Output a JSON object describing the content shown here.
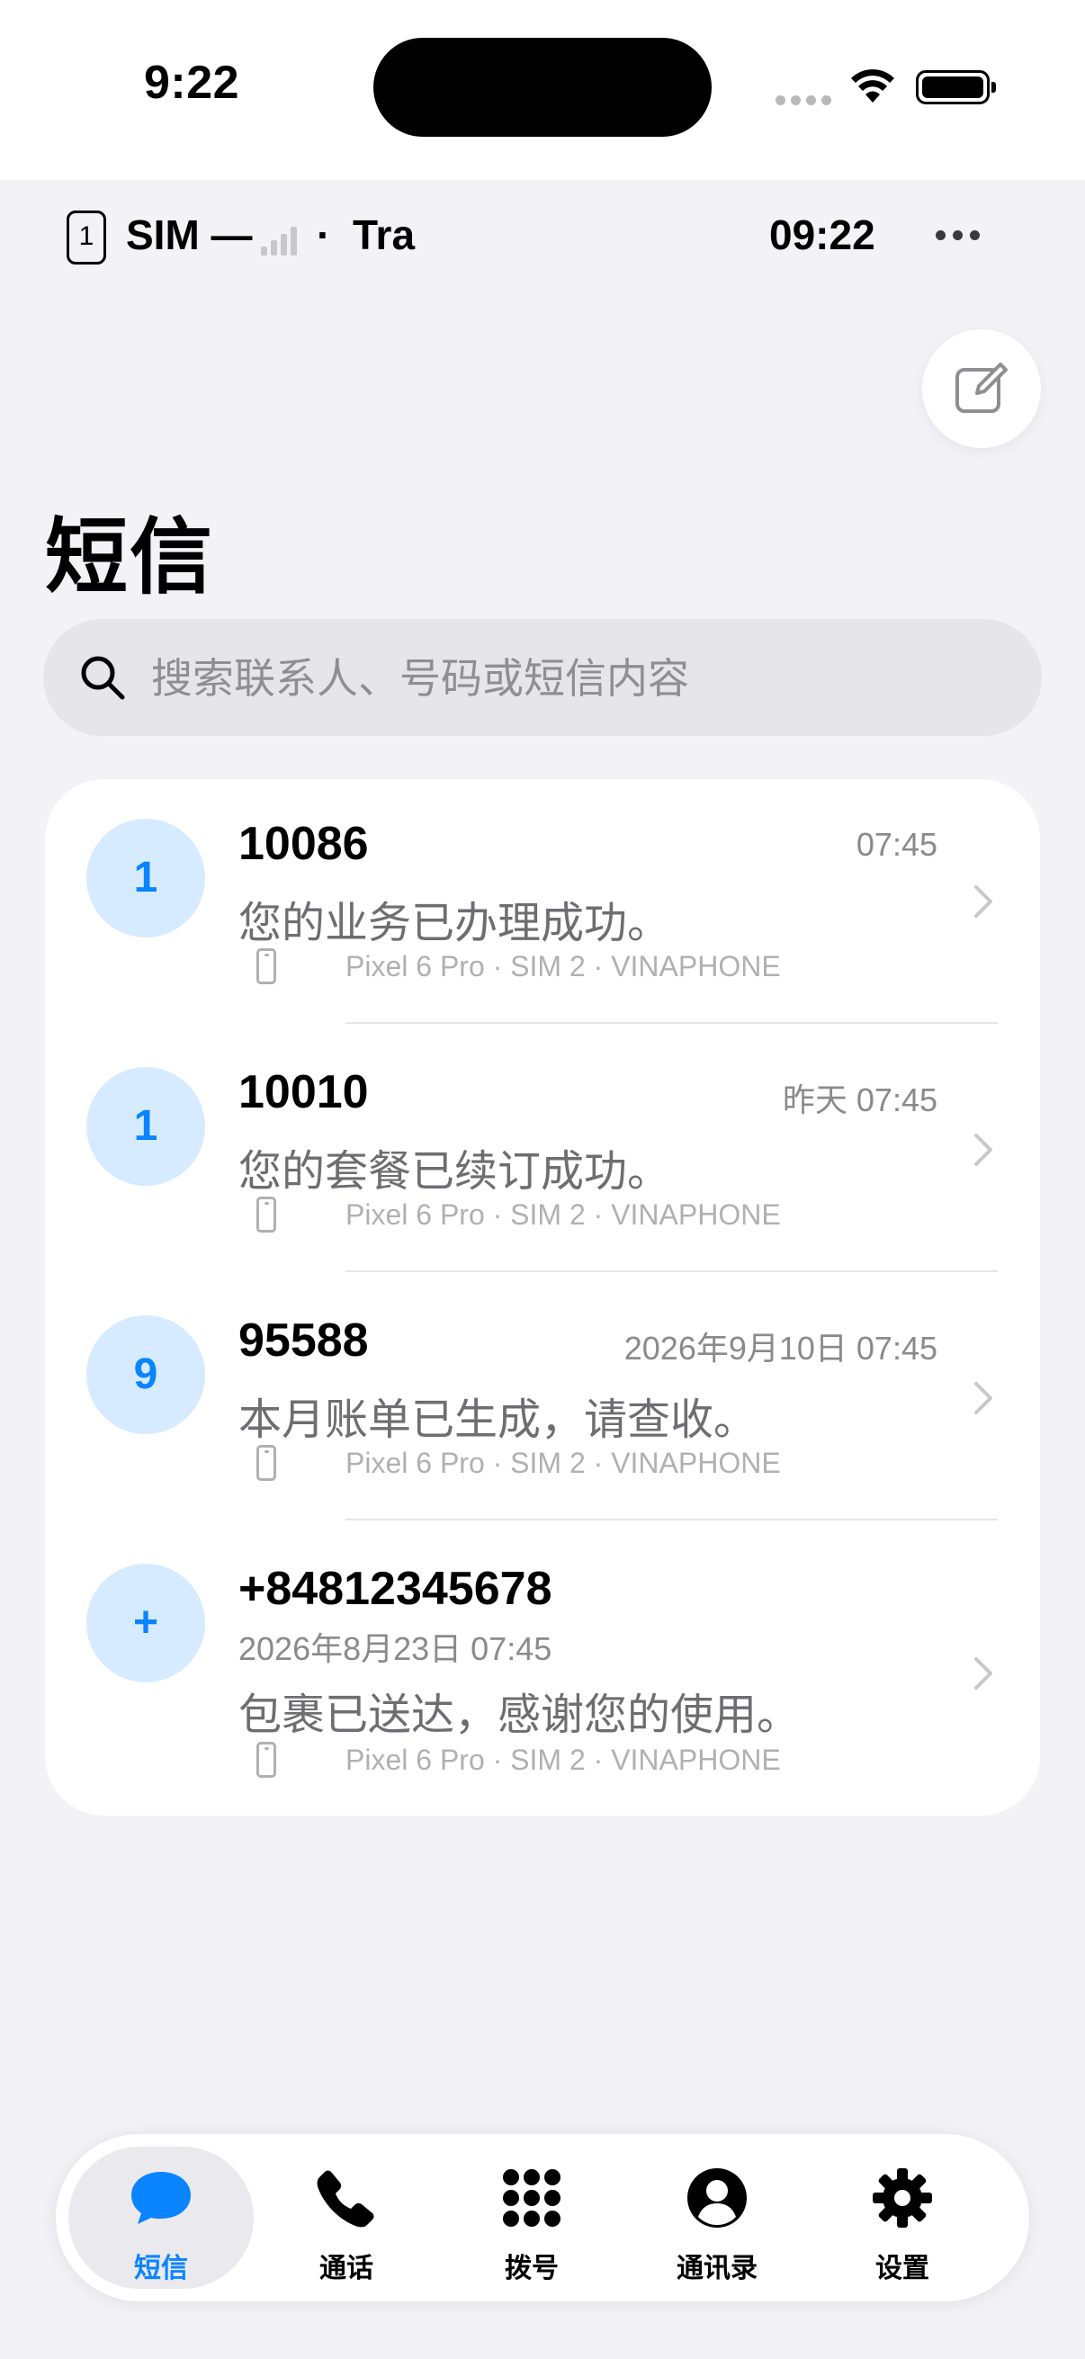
{
  "status_bar": {
    "time": "9:22"
  },
  "sim_bar": {
    "sim_number": "1",
    "sim_label": "SIM —",
    "separator": "·",
    "carrier": "Tra",
    "clock": "09:22"
  },
  "header": {
    "title": "短信",
    "search_placeholder": "搜索联系人、号码或短信内容"
  },
  "messages": [
    {
      "avatar": "1",
      "sender": "10086",
      "time": "07:45",
      "preview": "您的业务已办理成功。",
      "meta": "Pixel 6 Pro · SIM 2 · VINAPHONE"
    },
    {
      "avatar": "1",
      "sender": "10010",
      "time": "昨天 07:45",
      "preview": "您的套餐已续订成功。",
      "meta": "Pixel 6 Pro · SIM 2 · VINAPHONE"
    },
    {
      "avatar": "9",
      "sender": "95588",
      "time": "2026年9月10日 07:45",
      "preview": "本月账单已生成，请查收。",
      "meta": "Pixel 6 Pro · SIM 2 · VINAPHONE"
    },
    {
      "avatar": "+",
      "sender": "+84812345678",
      "time": "2026年8月23日 07:45",
      "preview": "包裹已送达，感谢您的使用。",
      "meta": "Pixel 6 Pro · SIM 2 · VINAPHONE"
    }
  ],
  "tabs": [
    {
      "label": "短信",
      "icon": "message-bubble-icon",
      "active": true
    },
    {
      "label": "通话",
      "icon": "phone-icon",
      "active": false
    },
    {
      "label": "拨号",
      "icon": "keypad-icon",
      "active": false
    },
    {
      "label": "通讯录",
      "icon": "contact-icon",
      "active": false
    },
    {
      "label": "设置",
      "icon": "gear-icon",
      "active": false
    }
  ],
  "colors": {
    "accent": "#0a84ff",
    "avatar_bg": "#d6ebff",
    "background": "#f2f2f7"
  }
}
